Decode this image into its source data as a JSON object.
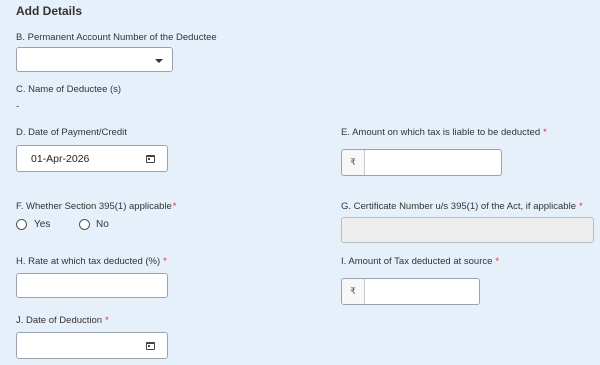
{
  "section_title": "Add Details",
  "fields": {
    "pan": {
      "label": "B. Permanent Account Number of the Deductee",
      "value": ""
    },
    "name": {
      "label": "C. Name of Deductee (s)",
      "value": "-"
    },
    "date_payment": {
      "label": "D. Date of Payment/Credit",
      "value": "01-Apr-2026"
    },
    "amount_liable": {
      "label": "E. Amount on which tax is liable to be deducted",
      "required": "*",
      "currency": "₹",
      "value": ""
    },
    "section395": {
      "label": "F. Whether Section 395(1) applicable",
      "required": "*",
      "options": [
        "Yes",
        "No"
      ]
    },
    "certificate": {
      "label": "G. Certificate Number u/s 395(1) of the Act, if applicable",
      "required": "*",
      "value": ""
    },
    "rate": {
      "label": "H. Rate at which tax deducted (%)",
      "required": "*",
      "value": ""
    },
    "tax_amount": {
      "label": "I. Amount of Tax deducted at source",
      "required": "*",
      "currency": "₹",
      "value": ""
    },
    "date_deduction": {
      "label": "J. Date of Deduction",
      "required": "*",
      "value": ""
    }
  },
  "icons": {
    "dropdown": "chevron-down-icon",
    "calendar": "calendar-icon"
  },
  "colors": {
    "background": "#e6f0fb",
    "required": "#e0342b",
    "disabled_field": "#eeeeee"
  }
}
